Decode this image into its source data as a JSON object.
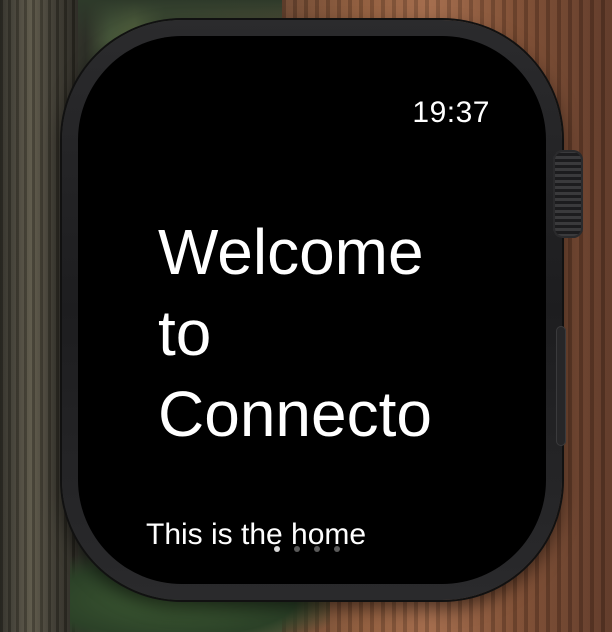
{
  "status_bar": {
    "time": "19:37"
  },
  "welcome": {
    "line1": "Welcome",
    "line2": "to",
    "line3": "Connecto"
  },
  "subtitle": "This is the home",
  "page_indicator": {
    "pages": 4,
    "current": 1
  },
  "colors": {
    "screen_background": "#000000",
    "text": "#ffffff",
    "watch_case": "#1d1d1f"
  }
}
